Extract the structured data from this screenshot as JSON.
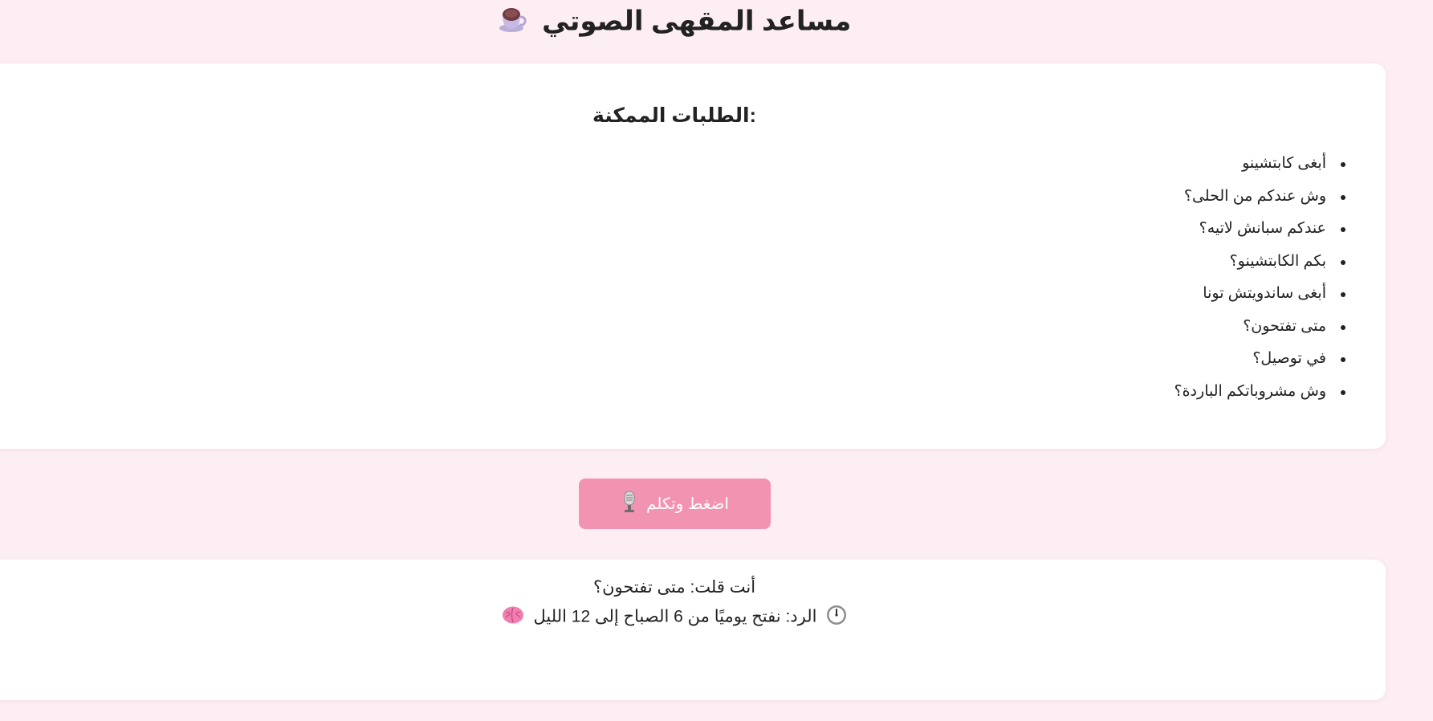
{
  "header": {
    "title": "مساعد المقهى الصوتي",
    "icon": "coffee-cup-icon"
  },
  "requests": {
    "heading": "الطلبات الممكنة:",
    "items": [
      "أبغى كابتشينو",
      "وش عندكم من الحلى؟",
      "عندكم سبانش لاتيه؟",
      "بكم الكابتشينو؟",
      "أبغى ساندويتش تونا",
      "متى تفتحون؟",
      "في توصيل؟",
      "وش مشروباتكم الباردة؟"
    ]
  },
  "talk_button": {
    "label": "اضغط وتكلم",
    "icon": "microphone-icon",
    "color": "#f393b2"
  },
  "response": {
    "you_said": "أنت قلت: متى تفتحون؟",
    "reply_text": "الرد: نفتح يوميًا من 6 الصباح إلى 12 الليل",
    "reply_icon_start": "clock-icon",
    "reply_icon_end": "brain-icon"
  },
  "colors": {
    "background": "#fdeef3",
    "card": "#ffffff",
    "accent": "#f393b2"
  }
}
